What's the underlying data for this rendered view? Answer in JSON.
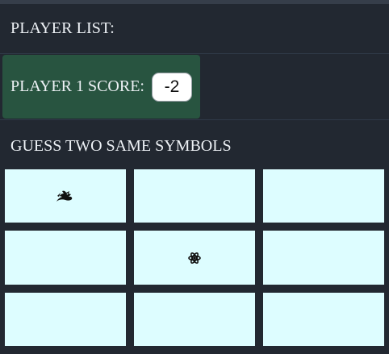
{
  "header": {
    "player_list_label": "PLAYER LIST:"
  },
  "players": [
    {
      "label": "PLAYER 1 SCORE:",
      "score": "-2"
    }
  ],
  "game": {
    "instruction": "GUESS TWO SAME SYMBOLS",
    "cards": [
      {
        "revealed": true,
        "symbol": "dragon-icon"
      },
      {
        "revealed": false,
        "symbol": ""
      },
      {
        "revealed": false,
        "symbol": ""
      },
      {
        "revealed": false,
        "symbol": ""
      },
      {
        "revealed": true,
        "symbol": "atom-icon"
      },
      {
        "revealed": false,
        "symbol": ""
      },
      {
        "revealed": false,
        "symbol": ""
      },
      {
        "revealed": false,
        "symbol": ""
      },
      {
        "revealed": false,
        "symbol": ""
      }
    ]
  },
  "colors": {
    "background": "#222831",
    "player_row": "#285440",
    "card": "#ddfdff"
  }
}
